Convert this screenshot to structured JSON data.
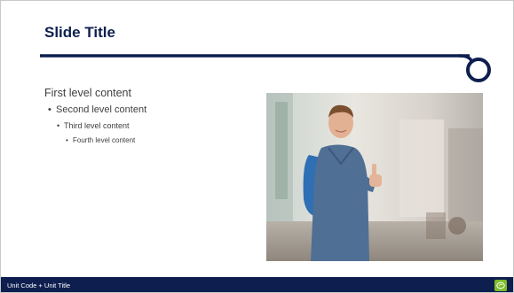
{
  "slide": {
    "title": "Slide Title",
    "content": {
      "first_level": "First level content",
      "second_level": "Second level content",
      "third_level": "Third level content",
      "fourth_level": "Fourth level content"
    },
    "bullet_glyph": "•",
    "footer_text": "Unit Code + Unit Title",
    "colors": {
      "navy": "#0e1f4f",
      "footer_bg": "#0e1f4f",
      "logo_green": "#7dbb2a",
      "body_text": "#404040"
    },
    "photo": {
      "subject": "young man with backpack giving thumbs up",
      "icon": "photo-image"
    },
    "logo": {
      "icon": "green-logo-icon"
    }
  }
}
